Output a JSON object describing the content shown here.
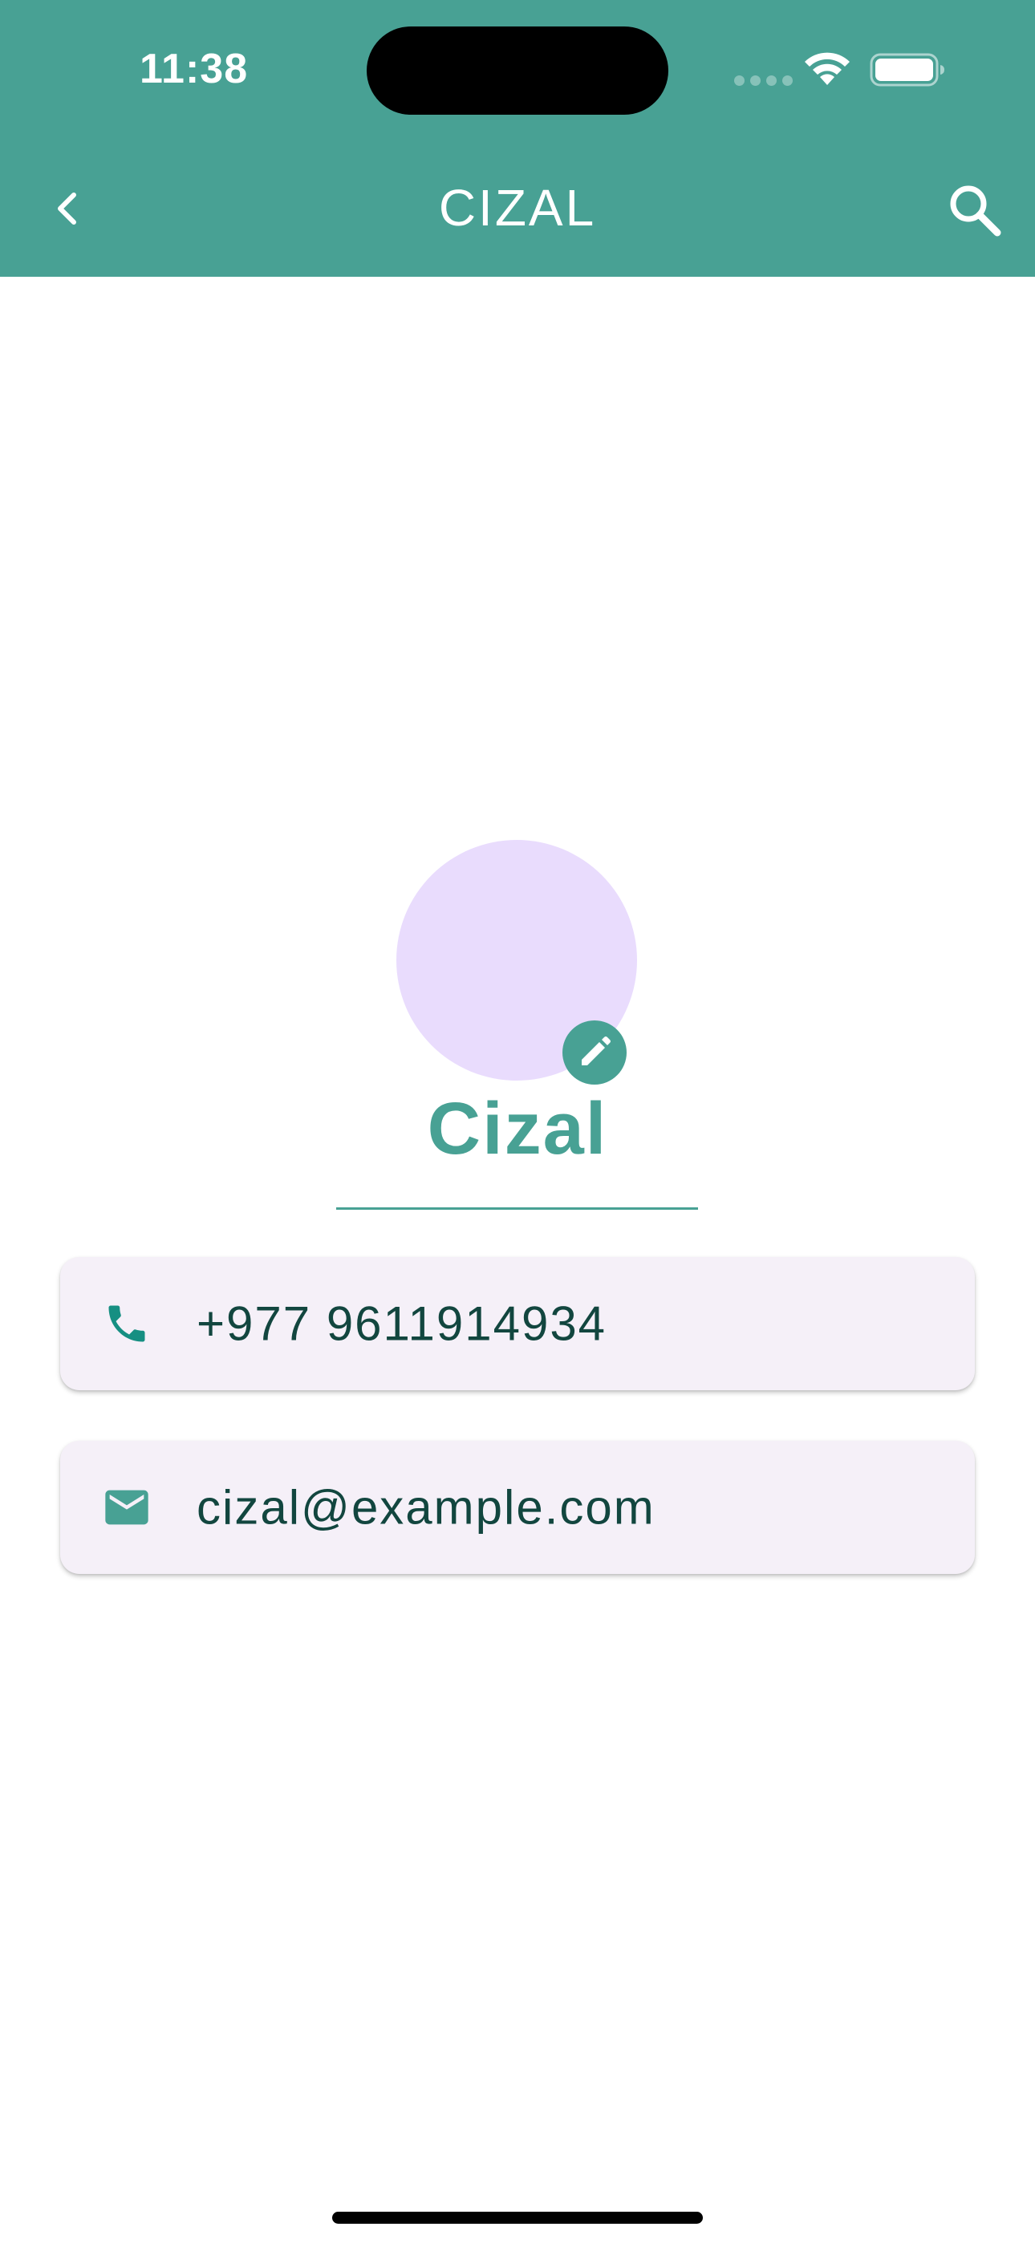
{
  "status_bar": {
    "time": "11:38"
  },
  "header": {
    "title": "CIZAL",
    "back_icon": "chevron-left-icon",
    "search_icon": "search-icon"
  },
  "profile": {
    "name": "Cizal",
    "edit_icon": "pencil-icon"
  },
  "details": {
    "phone": {
      "icon": "phone-icon",
      "value": "+977 9611914934"
    },
    "email": {
      "icon": "mail-icon",
      "value": "cizal@example.com"
    }
  },
  "colors": {
    "primary": "#48a194",
    "avatar_bg": "#e9dcfd",
    "card_bg": "#f5f0f8",
    "card_text": "#12463f",
    "phone_icon": "#168f82"
  }
}
